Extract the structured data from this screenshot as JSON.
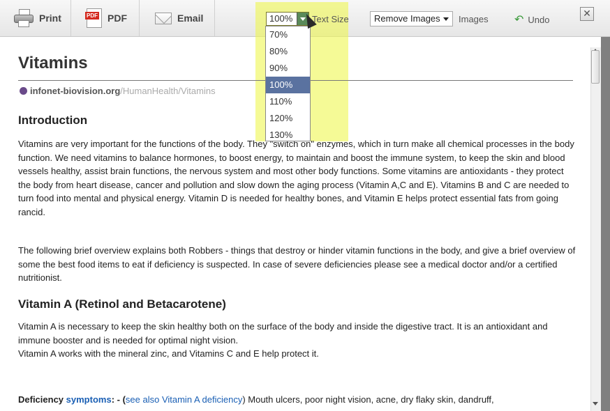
{
  "toolbar": {
    "print_label": "Print",
    "pdf_label": "PDF",
    "email_label": "Email",
    "text_size_value": "100%",
    "text_size_label": "Text Size",
    "text_size_options": [
      "70%",
      "80%",
      "90%",
      "100%",
      "110%",
      "120%",
      "130%"
    ],
    "text_size_selected_index": 3,
    "images_value": "Remove Images",
    "images_label": "Images",
    "undo_label": "Undo",
    "close_glyph": "✕"
  },
  "article": {
    "title": "Vitamins",
    "source_domain": "infonet-biovision.org",
    "source_path": "/HumanHealth/Vitamins",
    "intro_heading": "Introduction",
    "intro_text": "Vitamins are very important for the functions of the body. They \"switch on\" enzymes, which in turn make all chemical processes in the body function. We need vitamins to balance hormones, to boost energy, to maintain and boost the immune system, to keep the skin and blood vessels healthy, assist brain functions, the nervous system and most other body functions. Some vitamins are antioxidants - they protect the body from heart disease, cancer and pollution and slow down the aging process (Vitamin A,C and E). Vitamins B and C are needed to turn food into mental and physical energy. Vitamin D is needed for healthy bones, and Vitamin E helps protect essential fats from going rancid.",
    "overview_text": "The following brief overview explains both Robbers - things that destroy or hinder vitamin functions in the body, and give a brief overview of some the best food items to eat if deficiency is suspected. In case of severe deficiencies please see a medical doctor and/or a certified nutritionist.",
    "vitamin_a_heading": "Vitamin A (Retinol and Betacarotene)",
    "vitamin_a_text1": "Vitamin A is necessary to keep the skin healthy both on the surface of the body and inside the digestive tract. It is an antioxidant and immune booster and is needed for optimal night vision.",
    "vitamin_a_text2": "Vitamin A works with the mineral zinc, and Vitamins C and E help protect it.",
    "deficiency_label": "Deficiency ",
    "deficiency_link": "symptoms",
    "deficiency_sep": ": - (",
    "deficiency_see_also": "see also Vitamin A deficiency",
    "deficiency_rest": ") Mouth ulcers, poor night vision, acne, dry flaky skin, dandruff,"
  }
}
